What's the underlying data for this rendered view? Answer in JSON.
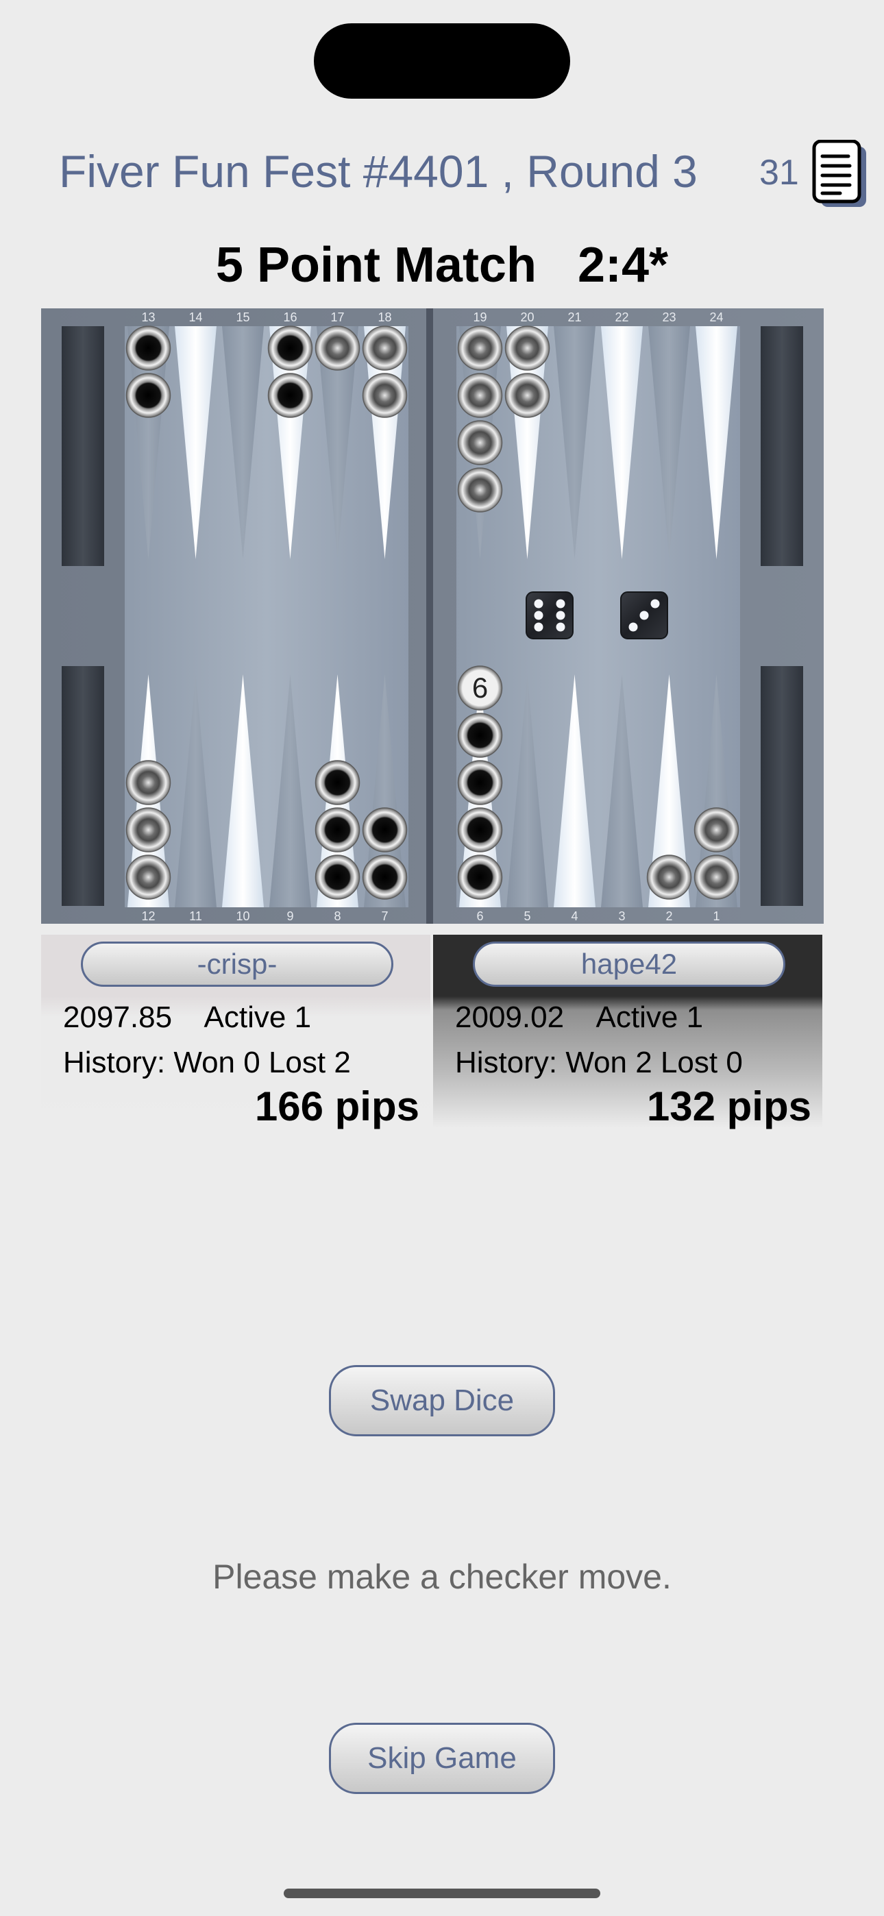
{
  "header": {
    "tournament_title": "Fiver Fun Fest #4401 , Round 3",
    "message_count": "31",
    "message_icon": "document-icon"
  },
  "match": {
    "title": "5 Point Match   2:4*"
  },
  "board": {
    "top_point_labels": [
      "13",
      "14",
      "15",
      "16",
      "17",
      "18",
      "19",
      "20",
      "21",
      "22",
      "23",
      "24"
    ],
    "bottom_point_labels": [
      "12",
      "11",
      "10",
      "9",
      "8",
      "7",
      "6",
      "5",
      "4",
      "3",
      "2",
      "1"
    ],
    "checkers": [
      {
        "point": 13,
        "color": "black",
        "count": 2
      },
      {
        "point": 16,
        "color": "black",
        "count": 2
      },
      {
        "point": 17,
        "color": "silver",
        "count": 1
      },
      {
        "point": 18,
        "color": "silver",
        "count": 2
      },
      {
        "point": 19,
        "color": "silver",
        "count": 4
      },
      {
        "point": 20,
        "color": "silver",
        "count": 2
      },
      {
        "point": 12,
        "color": "silver",
        "count": 3
      },
      {
        "point": 8,
        "color": "black",
        "count": 3
      },
      {
        "point": 7,
        "color": "black",
        "count": 2
      },
      {
        "point": 6,
        "color": "black",
        "count": 6,
        "stack_label": "6"
      },
      {
        "point": 2,
        "color": "silver",
        "count": 1
      },
      {
        "point": 1,
        "color": "silver",
        "count": 2
      }
    ],
    "dice": [
      6,
      3
    ]
  },
  "players": {
    "left": {
      "name": "-crisp-",
      "rating_line": "2097.85    Active 1",
      "history": "History: Won 0 Lost 2",
      "pips": "166 pips"
    },
    "right": {
      "name": "hape42",
      "rating_line": "2009.02    Active 1",
      "history": "History: Won 2 Lost 0",
      "pips": "132 pips"
    }
  },
  "actions": {
    "swap_dice": "Swap Dice",
    "status": "Please make a checker move.",
    "skip_game": "Skip Game"
  }
}
